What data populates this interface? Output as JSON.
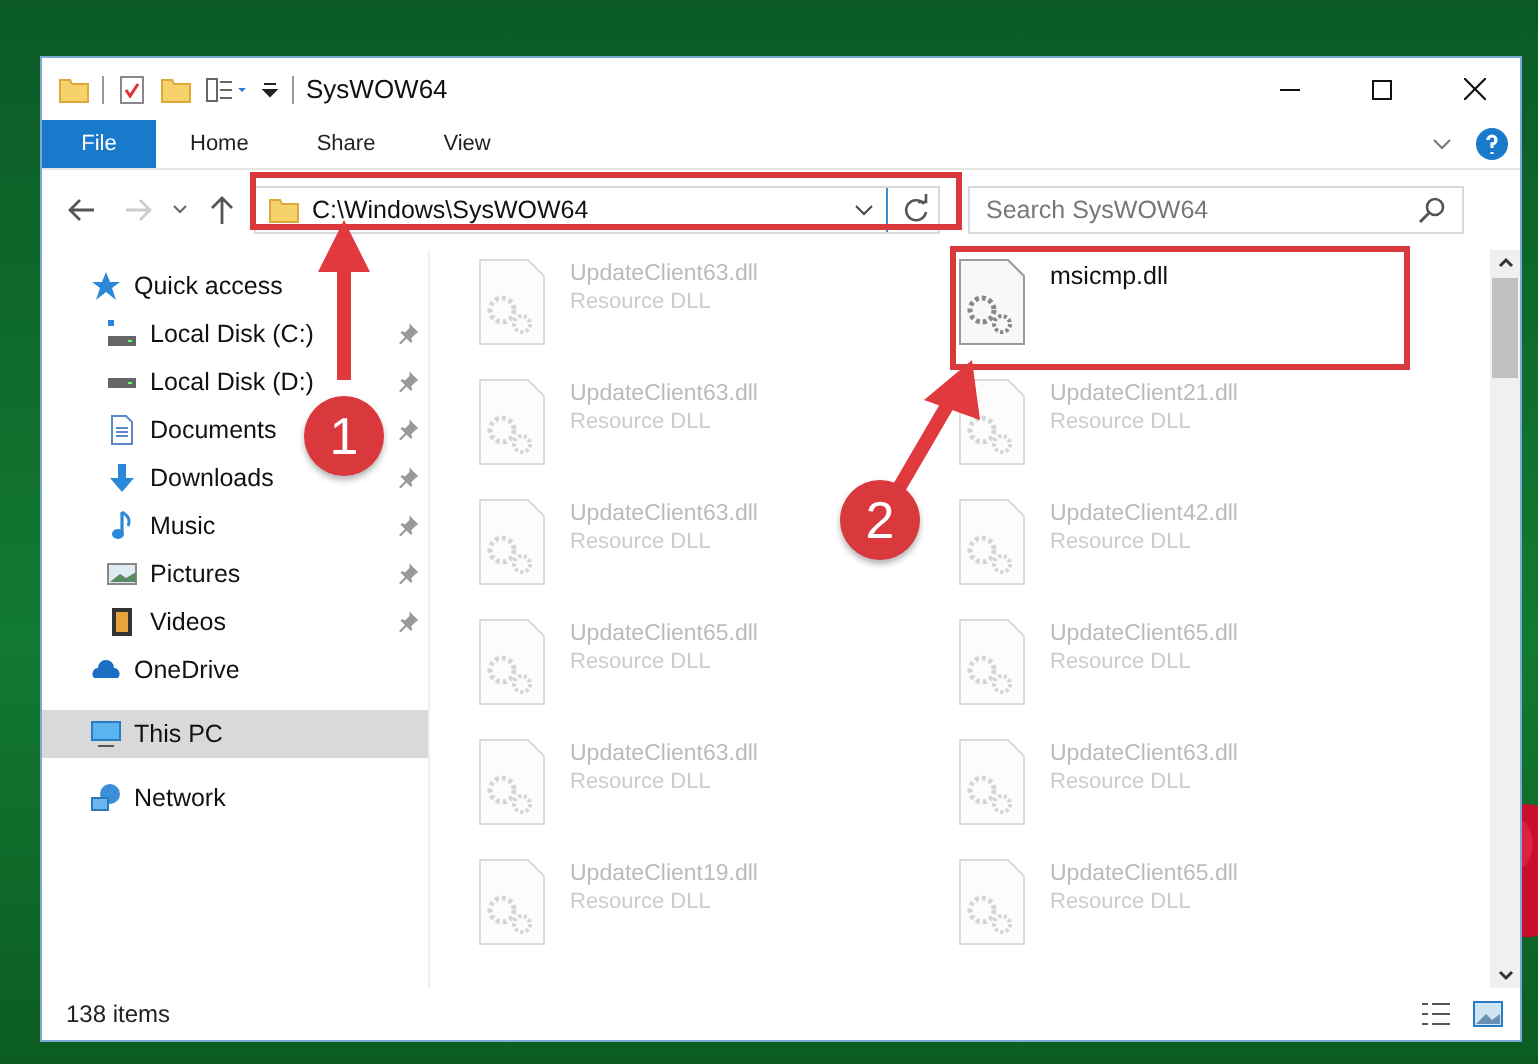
{
  "window": {
    "title": "SysWOW64"
  },
  "ribbon_tabs": [
    {
      "label": "File",
      "selected": true
    },
    {
      "label": "Home",
      "selected": false
    },
    {
      "label": "Share",
      "selected": false
    },
    {
      "label": "View",
      "selected": false
    }
  ],
  "address_bar": {
    "value": "C:\\Windows\\SysWOW64"
  },
  "search": {
    "placeholder": "Search SysWOW64"
  },
  "navigation": [
    {
      "label": "Quick access",
      "selected": false,
      "children": [
        {
          "label": "Local Disk (C:)",
          "pinned": true
        },
        {
          "label": "Local Disk (D:)",
          "pinned": true
        },
        {
          "label": "Documents",
          "pinned": true
        },
        {
          "label": "Downloads",
          "pinned": true
        },
        {
          "label": "Music",
          "pinned": true
        },
        {
          "label": "Pictures",
          "pinned": true
        },
        {
          "label": "Videos",
          "pinned": true
        }
      ]
    },
    {
      "label": "OneDrive",
      "selected": false
    },
    {
      "label": "This PC",
      "selected": true
    },
    {
      "label": "Network",
      "selected": false
    }
  ],
  "files": [
    {
      "name": "UpdateClient63.dll",
      "type": "Resource DLL",
      "blurred": true
    },
    {
      "name": "msicmp.dll",
      "blurred": false
    },
    {
      "name": "UpdateClient63.dll",
      "type": "Resource DLL",
      "blurred": true
    },
    {
      "name": "UpdateClient21.dll",
      "type": "Resource DLL",
      "blurred": true
    },
    {
      "name": "UpdateClient63.dll",
      "type": "Resource DLL",
      "blurred": true
    },
    {
      "name": "UpdateClient42.dll",
      "type": "Resource DLL",
      "blurred": true
    },
    {
      "name": "UpdateClient65.dll",
      "type": "Resource DLL",
      "blurred": true
    },
    {
      "name": "UpdateClient65.dll",
      "type": "Resource DLL",
      "blurred": true
    },
    {
      "name": "UpdateClient63.dll",
      "type": "Resource DLL",
      "blurred": true
    },
    {
      "name": "UpdateClient63.dll",
      "type": "Resource DLL",
      "blurred": true
    },
    {
      "name": "UpdateClient19.dll",
      "type": "Resource DLL",
      "blurred": true
    },
    {
      "name": "UpdateClient65.dll",
      "type": "Resource DLL",
      "blurred": true
    }
  ],
  "status_bar": {
    "item_count": "138 items"
  },
  "annotations": [
    {
      "number": "1"
    },
    {
      "number": "2"
    }
  ]
}
